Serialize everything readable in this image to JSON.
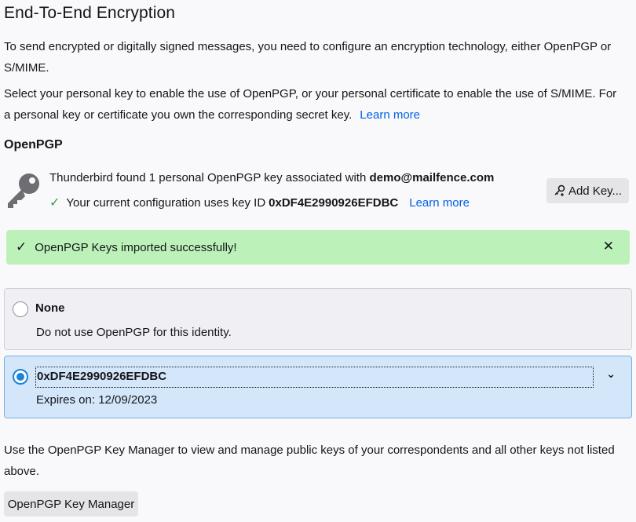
{
  "page": {
    "title": "End-To-End Encryption",
    "intro": "To send encrypted or digitally signed messages, you need to configure an encryption technology, either OpenPGP or S/MIME.",
    "select_text": "Select your personal key to enable the use of OpenPGP, or your personal certificate to enable the use of S/MIME. For a personal key or certificate you own the corresponding secret key.",
    "learn_more": "Learn more"
  },
  "openpgp": {
    "section_title": "OpenPGP",
    "found_prefix": "Thunderbird found 1 personal OpenPGP key associated with",
    "found_email": "demo@mailfence.com",
    "config_prefix": "Your current configuration uses key ID",
    "config_key_id": "0xDF4E2990926EFDBC",
    "learn_more": "Learn more",
    "add_key_label": "Add Key...",
    "add_key_icon": "key-plus-icon"
  },
  "notification": {
    "text": "OpenPGP Keys imported successfully!",
    "color": "#bcf2b9"
  },
  "options": {
    "none_label": "None",
    "none_desc": "Do not use OpenPGP for this identity.",
    "key_label": "0xDF4E2990926EFDBC",
    "key_desc": "Expires on: 12/09/2023",
    "selected": "0xDF4E2990926EFDBC"
  },
  "manager": {
    "text": "Use the OpenPGP Key Manager to view and manage public keys of your correspondents and all other keys not listed above.",
    "button_label": "OpenPGP Key Manager"
  },
  "colors": {
    "link": "#0061e0",
    "accent": "#1d83d6",
    "selected_bg": "#d4e7fa"
  }
}
